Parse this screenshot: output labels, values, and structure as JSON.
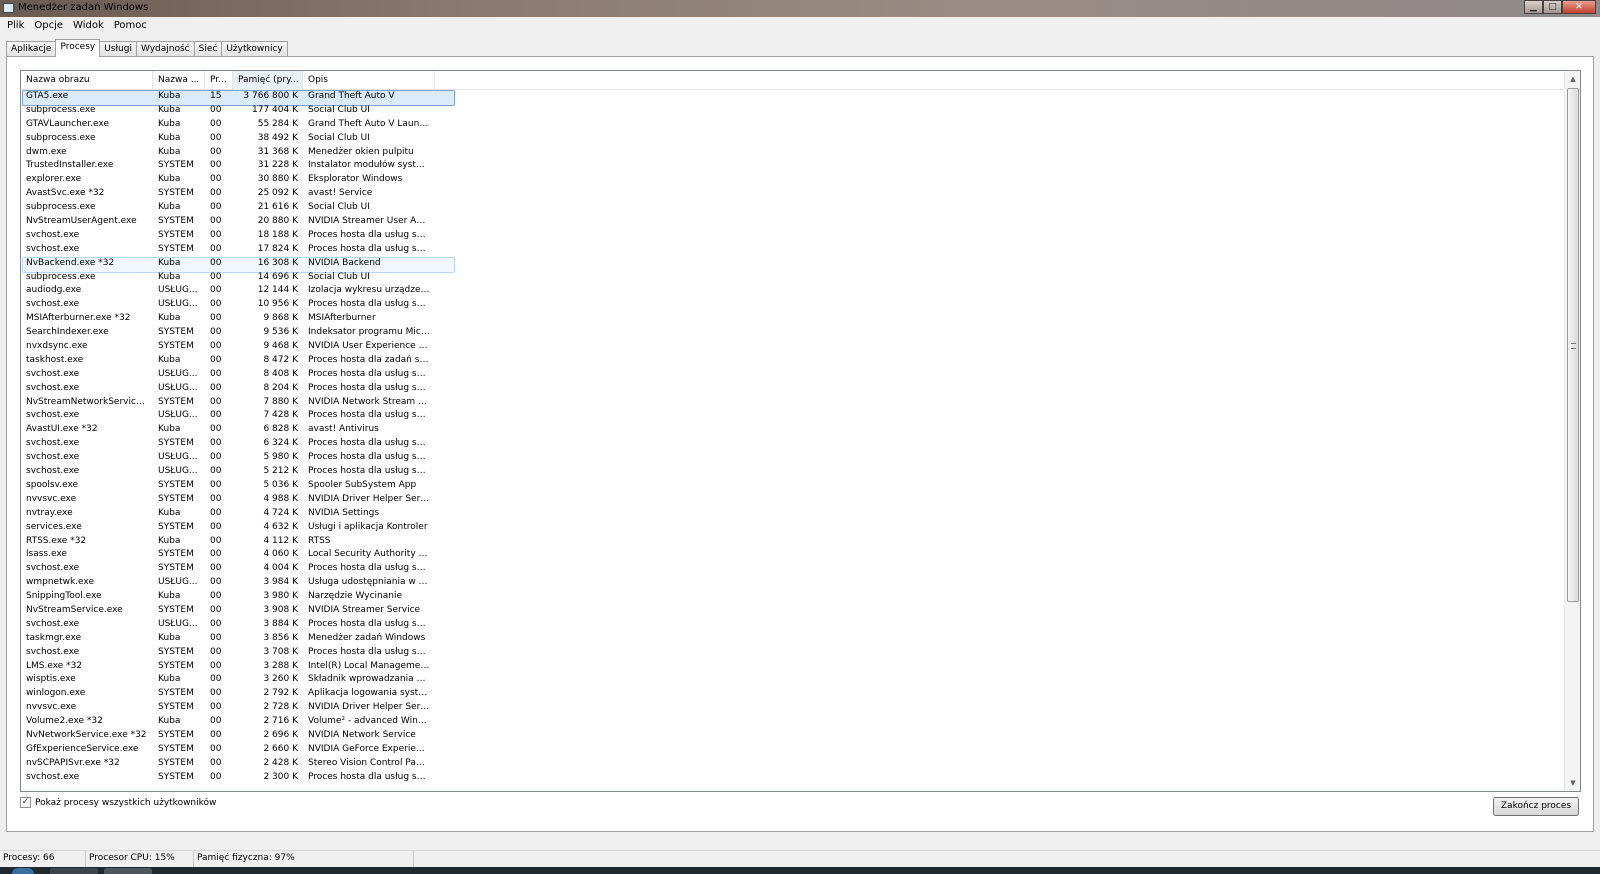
{
  "window": {
    "title": "Menedżer zadań Windows",
    "minimize": "▁",
    "maximize": "□",
    "close": "✕"
  },
  "menu": [
    "Plik",
    "Opcje",
    "Widok",
    "Pomoc"
  ],
  "tabs": [
    "Aplikacje",
    "Procesy",
    "Usługi",
    "Wydajność",
    "Sieć",
    "Użytkownicy"
  ],
  "active_tab": "Procesy",
  "columns": [
    "Nazwa obrazu",
    "Nazwa ...",
    "Pr...",
    "Pamięć (pry...",
    "Opis"
  ],
  "processes": [
    [
      "GTA5.exe",
      "Kuba",
      "15",
      "3 766 800 K",
      "Grand Theft Auto V"
    ],
    [
      "subprocess.exe",
      "Kuba",
      "00",
      "177 404 K",
      "Social Club UI"
    ],
    [
      "GTAVLauncher.exe",
      "Kuba",
      "00",
      "55 284 K",
      "Grand Theft Auto V Launcher"
    ],
    [
      "subprocess.exe",
      "Kuba",
      "00",
      "38 492 K",
      "Social Club UI"
    ],
    [
      "dwm.exe",
      "Kuba",
      "00",
      "31 368 K",
      "Menedżer okien pulpitu"
    ],
    [
      "TrustedInstaller.exe",
      "SYSTEM",
      "00",
      "31 228 K",
      "Instalator modułów system..."
    ],
    [
      "explorer.exe",
      "Kuba",
      "00",
      "30 880 K",
      "Eksplorator Windows"
    ],
    [
      "AvastSvc.exe *32",
      "SYSTEM",
      "00",
      "25 092 K",
      "avast! Service"
    ],
    [
      "subprocess.exe",
      "Kuba",
      "00",
      "21 616 K",
      "Social Club UI"
    ],
    [
      "NvStreamUserAgent.exe",
      "SYSTEM",
      "00",
      "20 880 K",
      "NVIDIA Streamer User Agent"
    ],
    [
      "svchost.exe",
      "SYSTEM",
      "00",
      "18 188 K",
      "Proces hosta dla usług syst..."
    ],
    [
      "svchost.exe",
      "SYSTEM",
      "00",
      "17 824 K",
      "Proces hosta dla usług syst..."
    ],
    [
      "NvBackend.exe *32",
      "Kuba",
      "00",
      "16 308 K",
      "NVIDIA Backend"
    ],
    [
      "subprocess.exe",
      "Kuba",
      "00",
      "14 696 K",
      "Social Club UI"
    ],
    [
      "audiodg.exe",
      "USŁUG...",
      "00",
      "12 144 K",
      "Izolacja wykresu urządzenia..."
    ],
    [
      "svchost.exe",
      "USŁUG...",
      "00",
      "10 956 K",
      "Proces hosta dla usług syst..."
    ],
    [
      "MSIAfterburner.exe *32",
      "Kuba",
      "00",
      "9 868 K",
      "MSIAfterburner"
    ],
    [
      "SearchIndexer.exe",
      "SYSTEM",
      "00",
      "9 536 K",
      "Indeksator programu Micros..."
    ],
    [
      "nvxdsync.exe",
      "SYSTEM",
      "00",
      "9 468 K",
      "NVIDIA User Experience Dri..."
    ],
    [
      "taskhost.exe",
      "Kuba",
      "00",
      "8 472 K",
      "Proces hosta dla zadań syst..."
    ],
    [
      "svchost.exe",
      "USŁUG...",
      "00",
      "8 408 K",
      "Proces hosta dla usług syst..."
    ],
    [
      "svchost.exe",
      "USŁUG...",
      "00",
      "8 204 K",
      "Proces hosta dla usług syst..."
    ],
    [
      "NvStreamNetworkService.exe",
      "SYSTEM",
      "00",
      "7 880 K",
      "NVIDIA Network Stream Ser..."
    ],
    [
      "svchost.exe",
      "USŁUG...",
      "00",
      "7 428 K",
      "Proces hosta dla usług syst..."
    ],
    [
      "AvastUI.exe *32",
      "Kuba",
      "00",
      "6 828 K",
      "avast! Antivirus"
    ],
    [
      "svchost.exe",
      "SYSTEM",
      "00",
      "6 324 K",
      "Proces hosta dla usług syst..."
    ],
    [
      "svchost.exe",
      "USŁUG...",
      "00",
      "5 980 K",
      "Proces hosta dla usług syst..."
    ],
    [
      "svchost.exe",
      "USŁUG...",
      "00",
      "5 212 K",
      "Proces hosta dla usług syst..."
    ],
    [
      "spoolsv.exe",
      "SYSTEM",
      "00",
      "5 036 K",
      "Spooler SubSystem App"
    ],
    [
      "nvvsvc.exe",
      "SYSTEM",
      "00",
      "4 988 K",
      "NVIDIA Driver Helper Servic..."
    ],
    [
      "nvtray.exe",
      "Kuba",
      "00",
      "4 724 K",
      "NVIDIA Settings"
    ],
    [
      "services.exe",
      "SYSTEM",
      "00",
      "4 632 K",
      "Usługi i aplikacja Kontroler"
    ],
    [
      "RTSS.exe *32",
      "Kuba",
      "00",
      "4 112 K",
      "RTSS"
    ],
    [
      "lsass.exe",
      "SYSTEM",
      "00",
      "4 060 K",
      "Local Security Authority Pro..."
    ],
    [
      "svchost.exe",
      "SYSTEM",
      "00",
      "4 004 K",
      "Proces hosta dla usług syst..."
    ],
    [
      "wmpnetwk.exe",
      "USŁUG...",
      "00",
      "3 984 K",
      "Usługa udostępniania w siec..."
    ],
    [
      "SnippingTool.exe",
      "Kuba",
      "00",
      "3 980 K",
      "Narzędzie Wycinanie"
    ],
    [
      "NvStreamService.exe",
      "SYSTEM",
      "00",
      "3 908 K",
      "NVIDIA Streamer Service"
    ],
    [
      "svchost.exe",
      "USŁUG...",
      "00",
      "3 884 K",
      "Proces hosta dla usług syst..."
    ],
    [
      "taskmgr.exe",
      "Kuba",
      "00",
      "3 856 K",
      "Menedżer zadań Windows"
    ],
    [
      "svchost.exe",
      "SYSTEM",
      "00",
      "3 708 K",
      "Proces hosta dla usług syst..."
    ],
    [
      "LMS.exe *32",
      "SYSTEM",
      "00",
      "3 288 K",
      "Intel(R) Local Management ..."
    ],
    [
      "wisptis.exe",
      "Kuba",
      "00",
      "3 260 K",
      "Składnik wprowadzania dot..."
    ],
    [
      "winlogon.exe",
      "SYSTEM",
      "00",
      "2 792 K",
      "Aplikacja logowania system..."
    ],
    [
      "nvvsvc.exe",
      "SYSTEM",
      "00",
      "2 728 K",
      "NVIDIA Driver Helper Servic..."
    ],
    [
      "Volume2.exe *32",
      "Kuba",
      "00",
      "2 716 K",
      "Volume² - advanced Windo..."
    ],
    [
      "NvNetworkService.exe *32",
      "SYSTEM",
      "00",
      "2 696 K",
      "NVIDIA Network Service"
    ],
    [
      "GfExperienceService.exe",
      "SYSTEM",
      "00",
      "2 660 K",
      "NVIDIA GeForce Experience..."
    ],
    [
      "nvSCPAPISvr.exe *32",
      "SYSTEM",
      "00",
      "2 428 K",
      "Stereo Vision Control Panel ..."
    ],
    [
      "svchost.exe",
      "SYSTEM",
      "00",
      "2 300 K",
      "Proces hosta dla usług syst..."
    ]
  ],
  "selected_row": 0,
  "hover_row": 12,
  "show_all_users": {
    "label": "Pokaż procesy wszystkich użytkowników",
    "checked": true,
    "mark": "✓"
  },
  "end_process_button": "Zakończ proces",
  "status": {
    "processes": "Procesy: 66",
    "cpu": "Procesor CPU: 15%",
    "memory": "Pamięć fizyczna: 97%"
  },
  "scroll_arrows": {
    "up": "▲",
    "down": "▼"
  }
}
